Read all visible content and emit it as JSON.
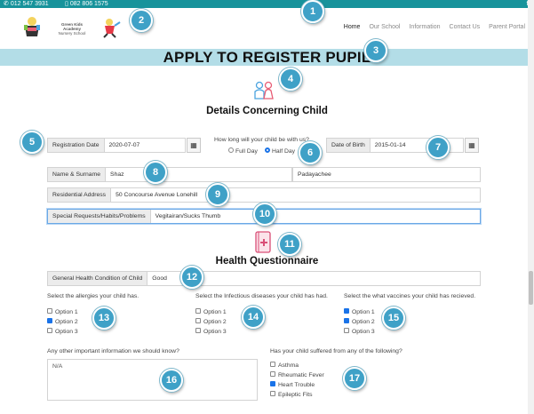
{
  "topbar": {
    "phone1": "012 547 3931",
    "phone2": "082 806 1575",
    "social": "f"
  },
  "logos": {
    "school_name_line1": "Green Kids Academy",
    "school_name_line2": "Nursery School"
  },
  "nav": [
    "Home",
    "Our School",
    "Information",
    "Contact Us",
    "Parent Portal"
  ],
  "banner": {
    "title": "APPLY TO REGISTER PUPIL"
  },
  "child_section": {
    "heading": "Details Concerning Child"
  },
  "registration": {
    "label": "Registration Date",
    "value": "2020-07-07"
  },
  "duration": {
    "question": "How long will your child be with us?",
    "option_full": "Full Day",
    "option_half": "Half Day",
    "selected": "Half Day"
  },
  "dob": {
    "label": "Date of Birth",
    "value": "2015-01-14"
  },
  "name": {
    "label": "Name & Surname",
    "first": "Shaz",
    "last": "Padayachee"
  },
  "address": {
    "label": "Residential Address",
    "value": "50 Concourse Avenue Lonehill"
  },
  "special": {
    "label": "Special Requests/Habits/Problems",
    "value": "Vegitairan/Sucks Thumb"
  },
  "health_section": {
    "heading": "Health Questionnaire"
  },
  "general_health": {
    "label": "General Health Condition of Child",
    "value": "Good"
  },
  "allergies": {
    "prompt": "Select the allergies your child has.",
    "options": [
      "Option 1",
      "Option 2",
      "Option 3"
    ],
    "checked": [
      false,
      true,
      false
    ]
  },
  "diseases": {
    "prompt": "Select the Infectious diseases your child has had.",
    "options": [
      "Option 1",
      "Option 2",
      "Option 3"
    ],
    "checked": [
      false,
      false,
      false
    ]
  },
  "vaccines": {
    "prompt": "Select the what vaccines your child has recieved.",
    "options": [
      "Option 1",
      "Option 2",
      "Option 3"
    ],
    "checked": [
      true,
      true,
      false
    ]
  },
  "other_info": {
    "prompt": "Any other important information we should know?",
    "value": "N/A"
  },
  "conditions": {
    "prompt": "Has your child suffered from any of the following?",
    "options": [
      "Asthma",
      "Rheumatic Fever",
      "Heart Trouble",
      "Epileptic Fits"
    ],
    "checked": [
      false,
      false,
      true,
      false
    ]
  },
  "badges": [
    "1",
    "2",
    "3",
    "4",
    "5",
    "6",
    "7",
    "8",
    "9",
    "10",
    "11",
    "12",
    "13",
    "14",
    "15",
    "16",
    "17"
  ],
  "colors": {
    "topbar": "#17939b",
    "banner": "#b3dde7",
    "badge": "#3fa1c7",
    "checked": "#1a73e8"
  },
  "icons": {
    "calendar": "calendar-icon",
    "phone": "phone-icon",
    "mobile": "mobile-icon",
    "children": "children-icon",
    "health_book": "health-book-icon"
  }
}
